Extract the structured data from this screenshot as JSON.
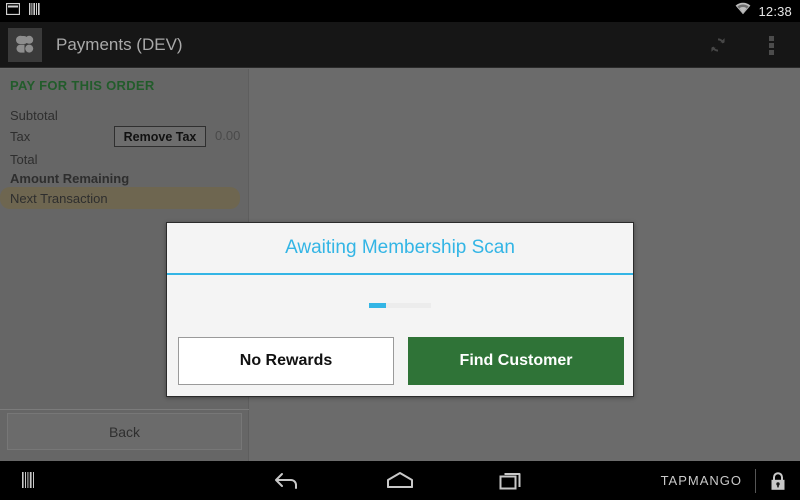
{
  "status_bar": {
    "icons": [
      "card-icon",
      "barcode-icon",
      "wifi-icon"
    ],
    "clock": "12:38"
  },
  "action_bar": {
    "app_icon": "clover-app-icon",
    "title": "Payments (DEV)",
    "refresh_icon": "refresh-icon",
    "overflow_icon": "overflow-menu-icon"
  },
  "order_panel": {
    "header": "PAY FOR THIS ORDER",
    "rows": [
      {
        "label": "Subtotal",
        "bold": false
      },
      {
        "label": "Tax",
        "bold": false
      },
      {
        "label": "Total",
        "bold": false
      },
      {
        "label": "Amount Remaining",
        "bold": true
      },
      {
        "label": "Next Transaction",
        "bold": false
      }
    ],
    "remove_tax_label": "Remove Tax",
    "tax_value": "0.00",
    "back_label": "Back"
  },
  "dialog": {
    "title": "Awaiting Membership Scan",
    "accent_color": "#33b5e5",
    "progress": {
      "indeterminate": true,
      "fill_color": "#33b5e5",
      "track_color": "#ececec"
    },
    "buttons": [
      {
        "label": "No Rewards",
        "style": "secondary"
      },
      {
        "label": "Find Customer",
        "style": "primary",
        "color": "#2f7337"
      }
    ]
  },
  "nav_bar": {
    "barcode_icon": "barcode-icon",
    "back_icon": "back-icon",
    "home_icon": "home-icon",
    "recents_icon": "recents-icon",
    "brand": "TAPMANGO",
    "lock_icon": "lock-icon"
  }
}
